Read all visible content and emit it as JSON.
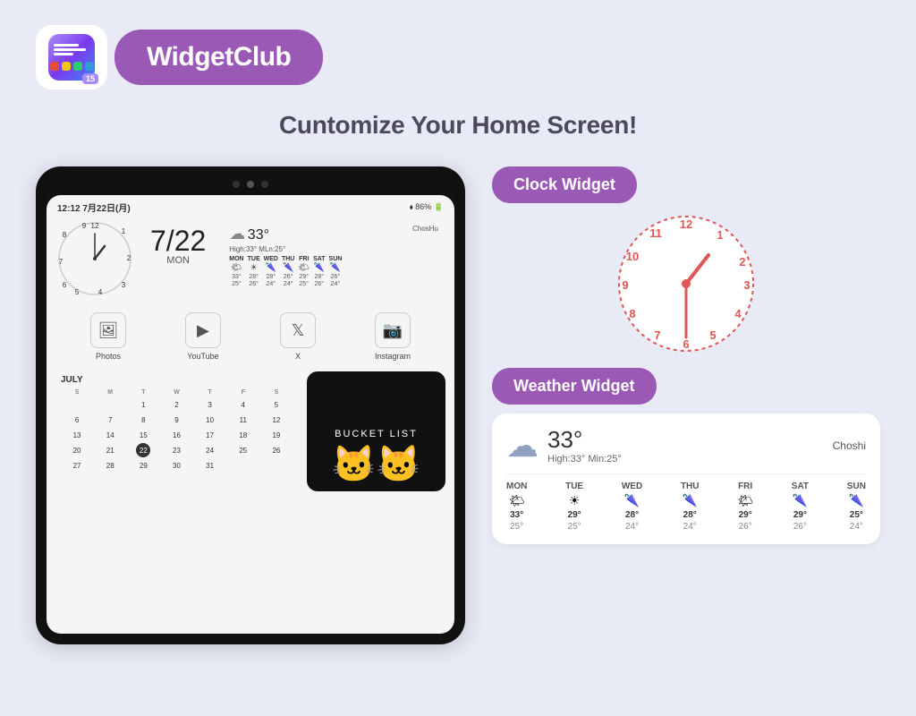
{
  "header": {
    "app_name": "WidgetClub",
    "subtitle": "Cuntomize Your Home Screen!"
  },
  "logo": {
    "badge": "15"
  },
  "clock_widget_label": "Clock Widget",
  "weather_widget_label": "Weather Widget",
  "tablet": {
    "time": "12:12",
    "date_str": "7月22日(月)",
    "battery": "86%",
    "date_display": "7/22",
    "day_display": "mon",
    "weather": {
      "icon": "☁",
      "temp": "33°",
      "high_low": "High:33°  MLn:25°",
      "location": "ChosHu",
      "days": [
        {
          "name": "MON",
          "icon": "🌤",
          "hi": "33°",
          "lo": "25°"
        },
        {
          "name": "TUE",
          "icon": "☀",
          "hi": "28°",
          "lo": "26°"
        },
        {
          "name": "WED",
          "icon": "🌂",
          "hi": "28°",
          "lo": "24°"
        },
        {
          "name": "THU",
          "icon": "🌂",
          "hi": "26°",
          "lo": "24°"
        },
        {
          "name": "FRI",
          "icon": "🌤",
          "hi": "29°",
          "lo": "25°"
        },
        {
          "name": "SAT",
          "icon": "🌂",
          "hi": "28°",
          "lo": "26°"
        },
        {
          "name": "SUN",
          "icon": "🌂",
          "hi": "26°",
          "lo": "24°"
        }
      ]
    },
    "apps": [
      {
        "label": "Photos",
        "icon": "🖼"
      },
      {
        "label": "YouTube",
        "icon": "▶"
      },
      {
        "label": "X",
        "icon": "𝕏"
      },
      {
        "label": "Instagram",
        "icon": "📷"
      }
    ],
    "calendar": {
      "month": "JULY",
      "headers": [
        "S",
        "M",
        "T",
        "W",
        "T",
        "F",
        "S"
      ],
      "cells": [
        "",
        "",
        "1",
        "2",
        "3",
        "4",
        "5",
        "6",
        "7",
        "8",
        "9",
        "10",
        "11",
        "12",
        "13",
        "14",
        "15",
        "16",
        "17",
        "18",
        "19",
        "20",
        "21",
        "22",
        "23",
        "24",
        "25",
        "26",
        "27",
        "28",
        "29",
        "30",
        "31",
        "",
        "",
        "",
        ""
      ]
    },
    "bucket_list_title": "Bucket List"
  },
  "clock_face": {
    "numbers": [
      {
        "n": "12",
        "angle": 0,
        "r": 64
      },
      {
        "n": "1",
        "angle": 30,
        "r": 64
      },
      {
        "n": "2",
        "angle": 60,
        "r": 64
      },
      {
        "n": "3",
        "angle": 90,
        "r": 64
      },
      {
        "n": "4",
        "angle": 120,
        "r": 64
      },
      {
        "n": "5",
        "angle": 150,
        "r": 64
      },
      {
        "n": "6",
        "angle": 180,
        "r": 64
      },
      {
        "n": "7",
        "angle": 210,
        "r": 64
      },
      {
        "n": "8",
        "angle": 240,
        "r": 64
      },
      {
        "n": "9",
        "angle": 270,
        "r": 64
      },
      {
        "n": "10",
        "angle": 300,
        "r": 64
      },
      {
        "n": "11",
        "angle": 330,
        "r": 64
      }
    ]
  },
  "weather_big": {
    "temp": "33°",
    "high_low": "High:33°  Min:25°",
    "location": "Choshi",
    "days": [
      {
        "name": "MON",
        "icon": "🌤",
        "hi": "33°",
        "lo": "25°"
      },
      {
        "name": "TUE",
        "icon": "☀",
        "hi": "29°",
        "lo": "25°"
      },
      {
        "name": "WED",
        "icon": "🌂",
        "hi": "28°",
        "lo": "24°"
      },
      {
        "name": "THU",
        "icon": "🌂",
        "hi": "28°",
        "lo": "24°"
      },
      {
        "name": "FRI",
        "icon": "🌤",
        "hi": "29°",
        "lo": "26°"
      },
      {
        "name": "SAT",
        "icon": "🌂",
        "hi": "29°",
        "lo": "26°"
      },
      {
        "name": "SUN",
        "icon": "🌂",
        "hi": "25°",
        "lo": "24°"
      }
    ]
  }
}
